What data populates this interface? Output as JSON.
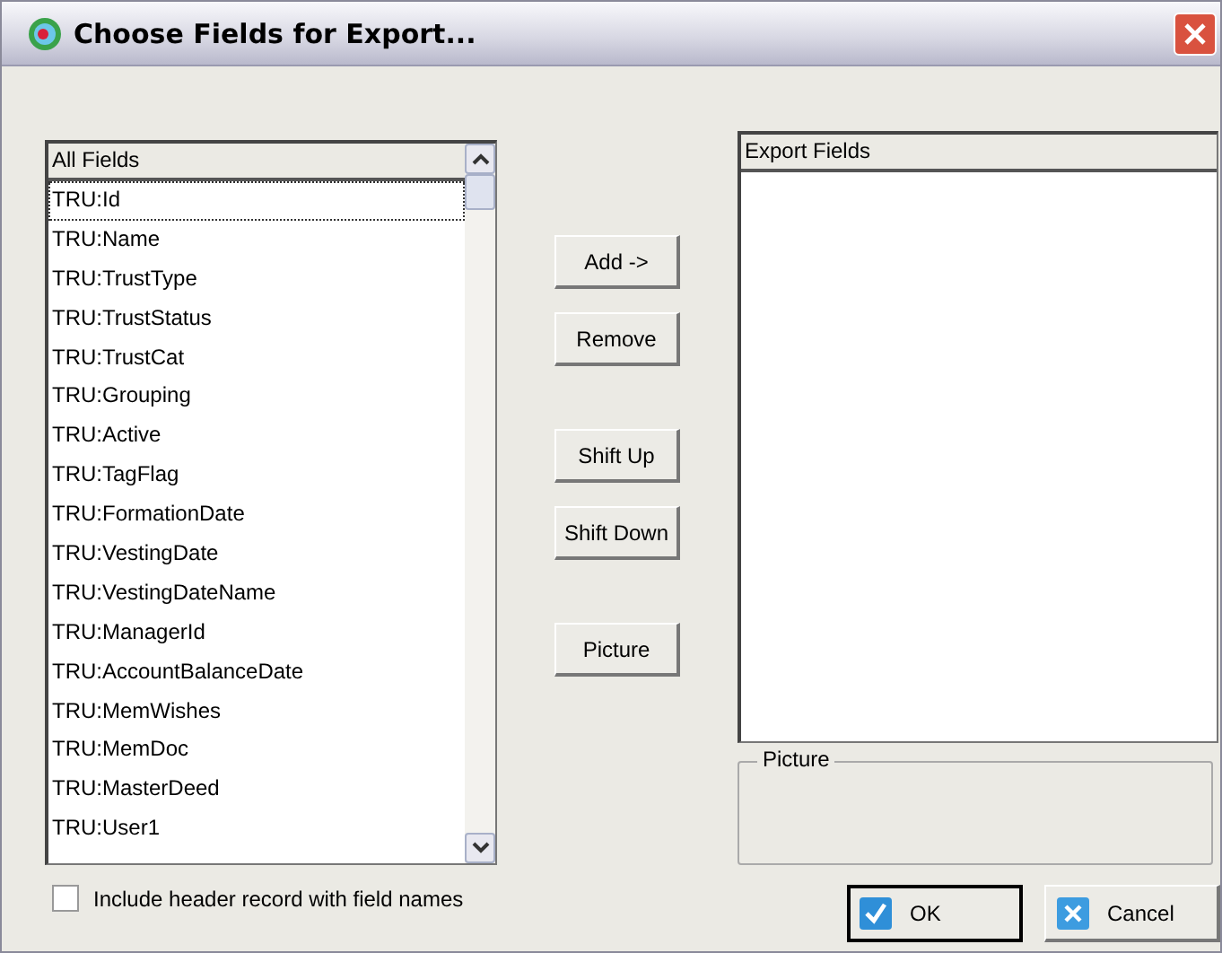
{
  "window": {
    "title": "Choose Fields for Export..."
  },
  "all_fields": {
    "header": "All Fields",
    "items": [
      {
        "label": "TRU:Id",
        "selected": true
      },
      {
        "label": "TRU:Name",
        "selected": false
      },
      {
        "label": "TRU:TrustType",
        "selected": false
      },
      {
        "label": "TRU:TrustStatus",
        "selected": false
      },
      {
        "label": "TRU:TrustCat",
        "selected": false
      },
      {
        "label": "TRU:Grouping",
        "selected": false
      },
      {
        "label": "TRU:Active",
        "selected": false
      },
      {
        "label": "TRU:TagFlag",
        "selected": false
      },
      {
        "label": "TRU:FormationDate",
        "selected": false
      },
      {
        "label": "TRU:VestingDate",
        "selected": false
      },
      {
        "label": "TRU:VestingDateName",
        "selected": false
      },
      {
        "label": "TRU:ManagerId",
        "selected": false
      },
      {
        "label": "TRU:AccountBalanceDate",
        "selected": false
      },
      {
        "label": "TRU:MemWishes",
        "selected": false
      },
      {
        "label": "TRU:MemDoc",
        "selected": false
      },
      {
        "label": "TRU:MasterDeed",
        "selected": false
      },
      {
        "label": "TRU:User1",
        "selected": false
      }
    ]
  },
  "middle_buttons": [
    {
      "label": "Add ->"
    },
    {
      "label": "Remove"
    },
    {
      "label": "Shift Up"
    },
    {
      "label": "Shift Down"
    },
    {
      "label": "Picture"
    }
  ],
  "export_fields": {
    "header": "Export Fields"
  },
  "picture_group": {
    "label": "Picture"
  },
  "include_header": {
    "label": "Include header record with field names",
    "checked": false
  },
  "buttons": [
    {
      "kind": "ok",
      "label": "OK",
      "default": true
    },
    {
      "kind": "cancel",
      "label": "Cancel",
      "default": false
    }
  ]
}
